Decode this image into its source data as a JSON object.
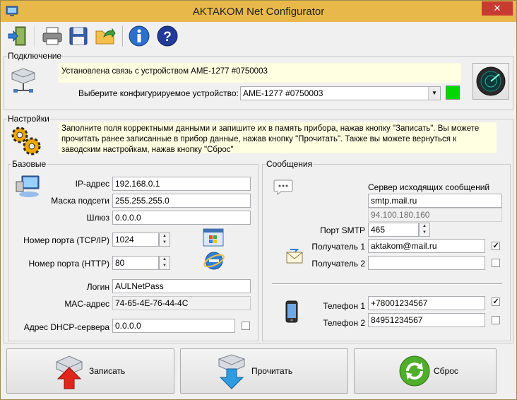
{
  "window": {
    "title": "AKTAKOM Net Configurator",
    "close_glyph": "✕"
  },
  "toolbar": {
    "buttons": [
      {
        "name": "exit",
        "icon": "exit-door-icon"
      },
      {
        "name": "print",
        "icon": "printer-icon"
      },
      {
        "name": "save",
        "icon": "floppy-disk-icon"
      },
      {
        "name": "open",
        "icon": "folder-open-icon"
      },
      {
        "name": "info",
        "icon": "info-icon"
      },
      {
        "name": "help",
        "icon": "help-icon"
      }
    ]
  },
  "connection": {
    "label": "Подключение",
    "status": "Установлена связь с устройством AME-1277 #0750003",
    "device_label": "Выберите конфигурируемое устройство:",
    "device_value": "AME-1277 #0750003",
    "indicator_color": "#00d800"
  },
  "settings": {
    "label": "Настройки",
    "hint": "Заполните поля корректными данными и запишите их в память прибора, нажав кнопку \"Записать\". Вы можете прочитать ранее записанные в прибор данные, нажав кнопку \"Прочитать\". Также вы можете вернуться к заводским настройкам, нажав кнопку \"Сброс\""
  },
  "basic": {
    "label": "Базовые",
    "ip_label": "IP-адрес",
    "ip": "192.168.0.1",
    "mask_label": "Маска подсети",
    "mask": "255.255.255.0",
    "gateway_label": "Шлюз",
    "gateway": "0.0.0.0",
    "tcp_port_label": "Номер порта (TCP/IP)",
    "tcp_port": "1024",
    "http_port_label": "Номер порта (HTTP)",
    "http_port": "80",
    "login_label": "Логин",
    "login": "AULNetPass",
    "mac_label": "MAC-адрес",
    "mac": "74-65-4E-76-44-4C",
    "dhcp_label": "Адрес DHCP-сервера",
    "dhcp": "0.0.0.0"
  },
  "messages": {
    "label": "Сообщения",
    "smtp_server_label": "Сервер исходящих сообщений",
    "smtp_server": "smtp.mail.ru",
    "smtp_ip": "94.100.180.160",
    "smtp_port_label": "Порт SMTP",
    "smtp_port": "465",
    "recipient1_label": "Получатель 1",
    "recipient1": "aktakom@mail.ru",
    "recipient2_label": "Получатель 2",
    "recipient2": "",
    "phone1_label": "Телефон 1",
    "phone1": "+78001234567",
    "phone2_label": "Телефон 2",
    "phone2": "84951234567"
  },
  "buttons": {
    "write": "Записать",
    "read": "Прочитать",
    "reset": "Сброс"
  },
  "checkmark": "✓"
}
